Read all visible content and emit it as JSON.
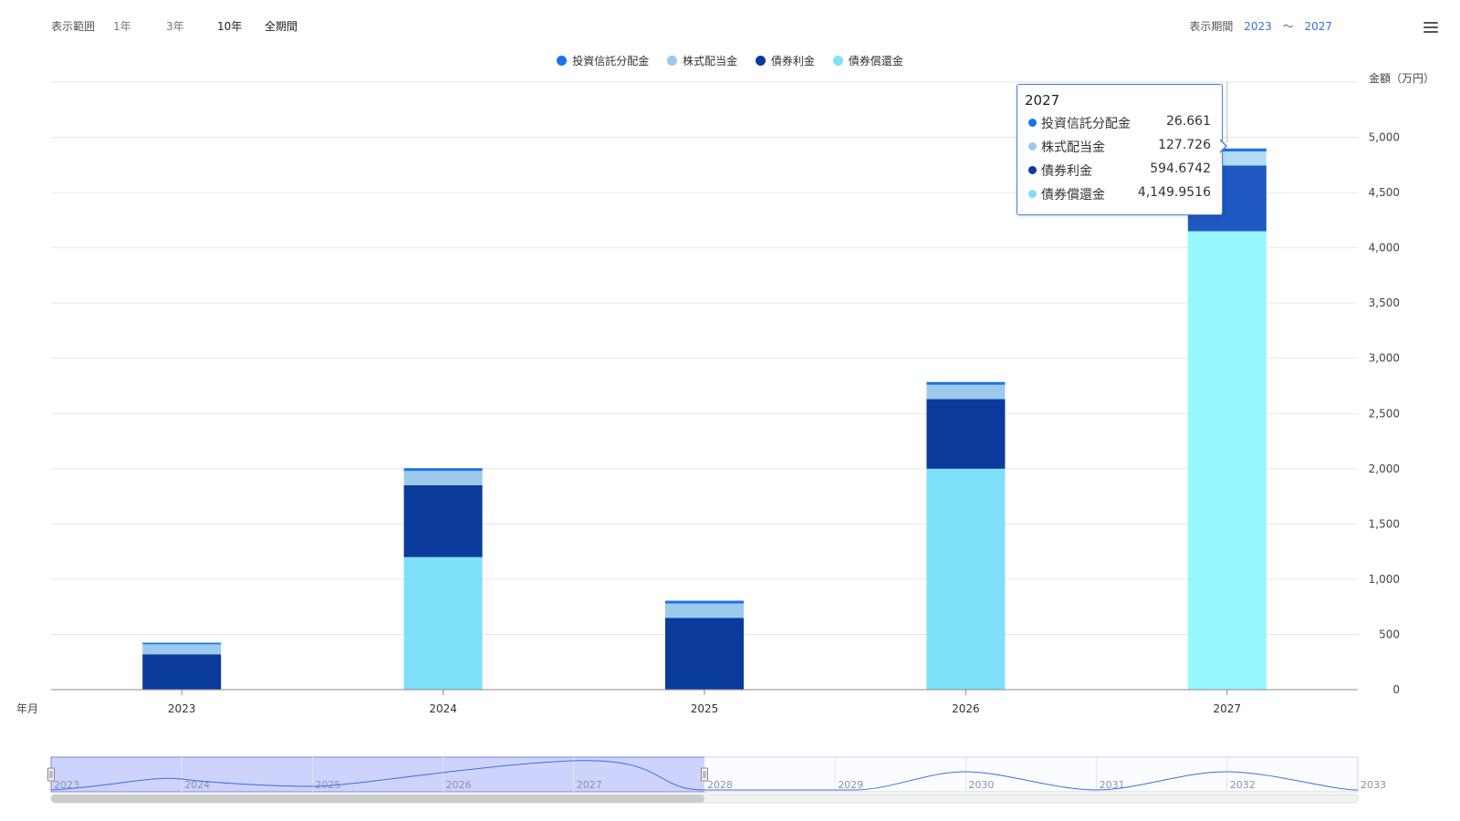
{
  "toolbar": {
    "range_label": "表示範囲",
    "range_buttons": [
      "1年",
      "3年",
      "10年",
      "全期間"
    ],
    "period_label": "表示期間",
    "period_from": "2023",
    "period_sep": "〜",
    "period_to": "2027"
  },
  "legend": [
    {
      "name": "投資信託分配金",
      "color": "#1a73e8"
    },
    {
      "name": "株式配当金",
      "color": "#9ccaec"
    },
    {
      "name": "債券利金",
      "color": "#0a3a9c"
    },
    {
      "name": "債券償還金",
      "color": "#7ee0fa"
    }
  ],
  "chart_data": {
    "type": "bar",
    "stacked": true,
    "categories": [
      "2023",
      "2024",
      "2025",
      "2026",
      "2027"
    ],
    "xlabel": "年月",
    "ylabel": "金額（万円）",
    "ylim": [
      0,
      5500
    ],
    "yticks": [
      0,
      500,
      1000,
      1500,
      2000,
      2500,
      3000,
      3500,
      4000,
      4500,
      5000
    ],
    "ytick_labels": [
      "0",
      "500",
      "1,000",
      "1,500",
      "2,000",
      "2,500",
      "3,000",
      "3,500",
      "4,000",
      "4,500",
      "5,000"
    ],
    "grid": true,
    "series": [
      {
        "name": "債券償還金",
        "values": [
          0,
          1200,
          0,
          2000,
          4149.9516
        ],
        "color": "#7ee0fa"
      },
      {
        "name": "債券利金",
        "values": [
          320,
          650,
          650,
          630,
          594.6742
        ],
        "color": "#0a3a9c"
      },
      {
        "name": "株式配当金",
        "values": [
          90,
          130,
          130,
          130,
          127.726
        ],
        "color": "#9ccaec"
      },
      {
        "name": "投資信託分配金",
        "values": [
          15,
          25,
          25,
          25,
          26.661
        ],
        "color": "#1a73e8"
      }
    ],
    "highlight_color": "#96f8ff"
  },
  "tooltip": {
    "title": "2027",
    "rows": [
      {
        "name": "投資信託分配金",
        "value": "26.661",
        "color": "#1a73e8"
      },
      {
        "name": "株式配当金",
        "value": "127.726",
        "color": "#9ccaec"
      },
      {
        "name": "債券利金",
        "value": "594.6742",
        "color": "#0a3a9c"
      },
      {
        "name": "債券償還金",
        "value": "4,149.9516",
        "color": "#7ee0fa"
      }
    ]
  },
  "navigator": {
    "years": [
      "2023",
      "2024",
      "2025",
      "2026",
      "2027",
      "2028",
      "2029",
      "2030",
      "2031",
      "2032",
      "2033"
    ],
    "selected_range": [
      "2023",
      "2028"
    ]
  }
}
